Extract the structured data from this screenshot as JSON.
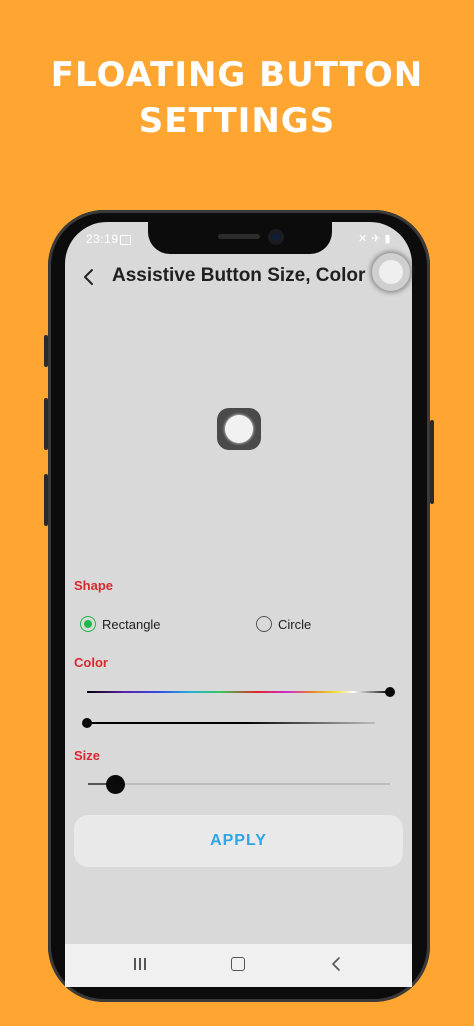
{
  "promo": {
    "line1": "FLOATING BUTTON",
    "line2": "SETTINGS"
  },
  "status_bar": {
    "time": "23:19",
    "icons": [
      "image-icon",
      "mute-icon",
      "wifi-icon",
      "battery-icon"
    ]
  },
  "header": {
    "title": "Assistive Button Size, Color",
    "back_icon": "chevron-left-icon"
  },
  "shape": {
    "label": "Shape",
    "options": [
      {
        "label": "Rectangle",
        "selected": true
      },
      {
        "label": "Circle",
        "selected": false
      }
    ]
  },
  "color": {
    "label": "Color",
    "hue_value": 1.0,
    "shade_value": 0.0
  },
  "size": {
    "label": "Size",
    "value": 0.1
  },
  "apply": {
    "label": "APPLY"
  },
  "colors": {
    "background": "#FFA531",
    "screen": "#d9d9d9",
    "section_label": "#d9282e",
    "apply_text": "#2ea4e4",
    "radio_selected": "#1fb84a"
  },
  "nav_bar": {
    "icons": [
      "recent-apps-icon",
      "home-icon",
      "back-icon"
    ]
  }
}
